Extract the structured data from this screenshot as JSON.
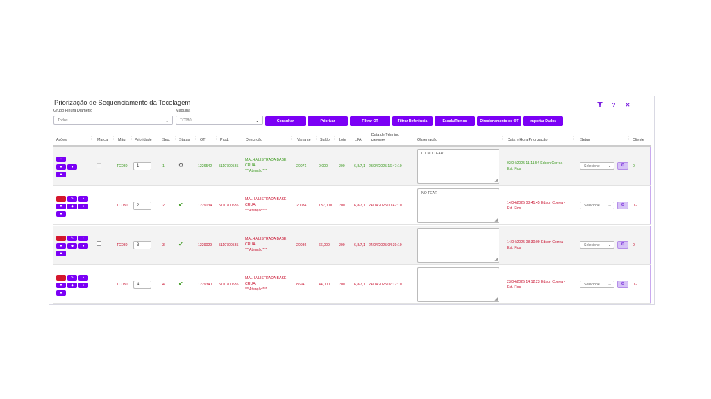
{
  "title": "Priorização de Sequenciamento da Tecelagem",
  "header_icons": [
    {
      "name": "filter-icon",
      "glyph": "funnel"
    },
    {
      "name": "help-icon",
      "glyph": "?"
    },
    {
      "name": "close-icon",
      "glyph": "✕"
    }
  ],
  "filters": {
    "grupo_label": "Grupo Finura Diâmetro",
    "grupo_value": "Todos",
    "maquina_label": "Máquina",
    "maquina_value": "TC080"
  },
  "toolbar": {
    "consultar": "Consultar",
    "priorizar": "Priorizar",
    "filtrar_ot": "Filtrar OT",
    "filtrar_referencia": "Filtrar Referência",
    "escala_turnos": "Escala/Turnos",
    "direcionamento": "Direcionamento de OT",
    "importar": "Importar Dados"
  },
  "columns": {
    "acoes": "Ações",
    "marcar": "Marcar",
    "maq": "Máq.",
    "prioridade": "Prioridade",
    "seq": "Seq.",
    "status": "Status",
    "ot": "OT",
    "prod": "Prod.",
    "descricao": "Descrição",
    "variante": "Variante",
    "saldo": "Saldo",
    "lote": "Lote",
    "lfa": "LFA",
    "data_termino_1": "Data de Término",
    "data_termino_2": "Previsto",
    "observacao": "Observação",
    "data_hora": "Data e Hora Priorização",
    "setup": "Setup",
    "cliente": "Cliente"
  },
  "colors": {
    "accent": "#7b00f5",
    "danger": "#d4172d",
    "green": "#3c9a1f",
    "red_text": "#c8102e"
  },
  "rows": [
    {
      "maq": "TC080",
      "prioridade": "1",
      "seq": "1",
      "status": "settings-icon",
      "ot": "1226542",
      "prod": "5110700535",
      "desc1": "MALHA LISTRADA BASE",
      "desc2": "CRUA",
      "desc3": "***Atenção***",
      "variante": "20071",
      "saldo": "0,000",
      "lote": "200",
      "lfa": "6,8/7,1",
      "data_termino": "23/04/2025 16:47:10",
      "observacao": "OT NO TEAR",
      "data_hora_1": "02/04/2025 11:11:54 Edson Correa -",
      "data_hora_2": "Est. Fios",
      "setup": "Selecione",
      "cliente": "0 -"
    },
    {
      "maq": "TC080",
      "prioridade": "2",
      "seq": "2",
      "status": "check-icon",
      "ot": "1229034",
      "prod": "5110700535",
      "desc1": "MALHA LISTRADA BASE",
      "desc2": "CRUA",
      "desc3": "***Atenção***",
      "variante": "20084",
      "saldo": "132,000",
      "lote": "200",
      "lfa": "6,8/7,1",
      "data_termino": "24/04/2025 00:42:10",
      "observacao": "NO TEAR",
      "data_hora_1": "14/04/2025 08:41:45 Edson Correa -",
      "data_hora_2": "Est. Fios",
      "setup": "Selecione",
      "cliente": "0 -"
    },
    {
      "maq": "TC080",
      "prioridade": "3",
      "seq": "3",
      "status": "check-icon",
      "ot": "1229029",
      "prod": "5110700535",
      "desc1": "MALHA LISTRADA BASE",
      "desc2": "CRUA",
      "desc3": "***Atenção***",
      "variante": "20086",
      "saldo": "66,000",
      "lote": "200",
      "lfa": "6,8/7,1",
      "data_termino": "24/04/2025 04:39:10",
      "observacao": "",
      "data_hora_1": "14/04/2025 08:30:09 Edson Correa -",
      "data_hora_2": "Est. Fios",
      "setup": "Selecione",
      "cliente": "0 -"
    },
    {
      "maq": "TC080",
      "prioridade": "4",
      "seq": "4",
      "status": "check-icon",
      "ot": "1229340",
      "prod": "5110700535",
      "desc1": "MALHA LISTRADA BASE",
      "desc2": "CRUA",
      "desc3": "***Atenção***",
      "variante": "8694",
      "saldo": "44,000",
      "lote": "200",
      "lfa": "6,8/7,1",
      "data_termino": "24/04/2025 07:17:10",
      "observacao": "",
      "data_hora_1": "23/04/2025 14:12:23 Edson Correa -",
      "data_hora_2": "Est. Fios",
      "setup": "Selecione",
      "cliente": "0 -"
    }
  ]
}
